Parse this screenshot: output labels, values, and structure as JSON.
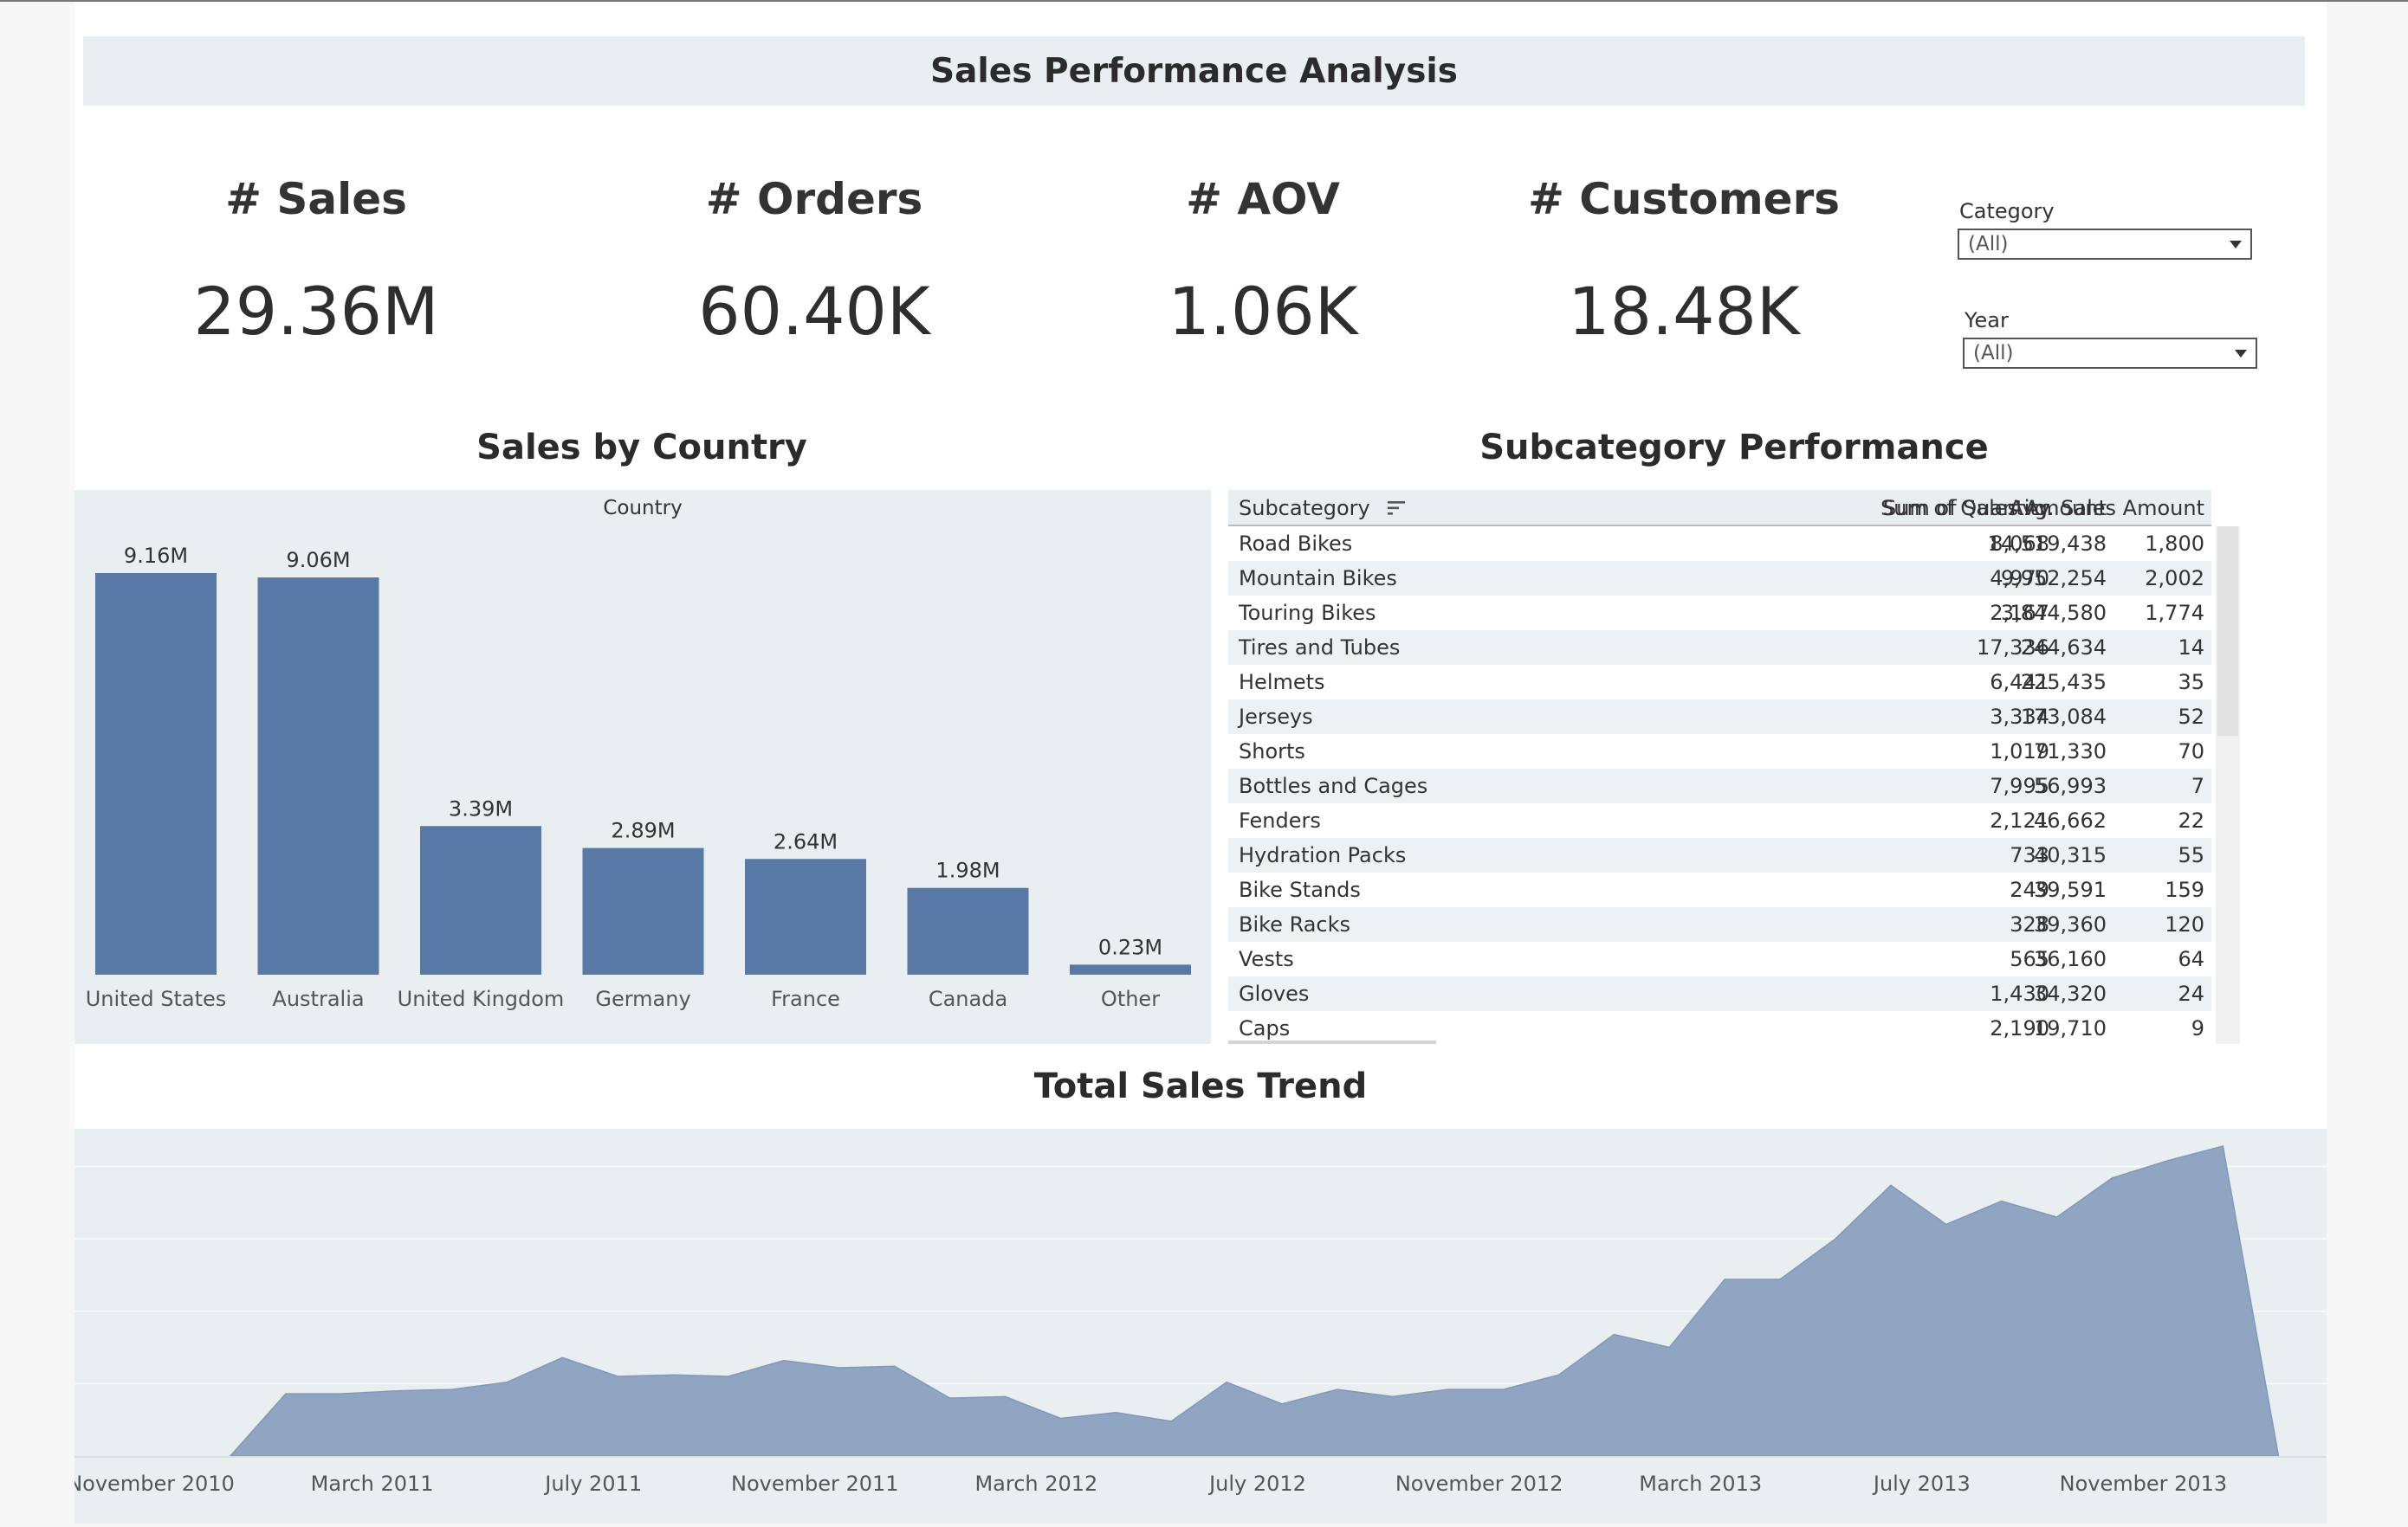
{
  "dashboard": {
    "title": "Sales Performance Analysis"
  },
  "kpis": [
    {
      "label": "# Sales",
      "value": "29.36M"
    },
    {
      "label": "# Orders",
      "value": "60.40K"
    },
    {
      "label": "# AOV",
      "value": "1.06K"
    },
    {
      "label": "# Customers",
      "value": "18.48K"
    }
  ],
  "filters": {
    "category": {
      "label": "Category",
      "value": "(All)"
    },
    "year": {
      "label": "Year",
      "value": "(All)"
    }
  },
  "country_section": {
    "title": "Sales by Country"
  },
  "subcategory_section": {
    "title": "Subcategory Performance"
  },
  "trend_section": {
    "title": "Total Sales Trend"
  },
  "colors": {
    "bar": "#5879a6",
    "area": "#8fa5c2",
    "panel": "#e9eef1"
  },
  "subcategory_table": {
    "headers": [
      "Subcategory",
      "Sum of Quantity",
      "Sum of Sales Amount",
      "Avg. Sales Amount"
    ],
    "sort_icon": "sort-descending-icon",
    "rows": [
      [
        "Road Bikes",
        "8,068",
        "14,519,438",
        "1,800"
      ],
      [
        "Mountain Bikes",
        "4,970",
        "9,952,254",
        "2,002"
      ],
      [
        "Touring Bikes",
        "2,167",
        "3,844,580",
        "1,774"
      ],
      [
        "Tires and Tubes",
        "17,336",
        "244,634",
        "14"
      ],
      [
        "Helmets",
        "6,441",
        "225,435",
        "35"
      ],
      [
        "Jerseys",
        "3,334",
        "173,084",
        "52"
      ],
      [
        "Shorts",
        "1,019",
        "71,330",
        "70"
      ],
      [
        "Bottles and Cages",
        "7,995",
        "56,993",
        "7"
      ],
      [
        "Fenders",
        "2,121",
        "46,662",
        "22"
      ],
      [
        "Hydration Packs",
        "733",
        "40,315",
        "55"
      ],
      [
        "Bike Stands",
        "249",
        "39,591",
        "159"
      ],
      [
        "Bike Racks",
        "328",
        "39,360",
        "120"
      ],
      [
        "Vests",
        "565",
        "36,160",
        "64"
      ],
      [
        "Gloves",
        "1,430",
        "34,320",
        "24"
      ],
      [
        "Caps",
        "2,190",
        "19,710",
        "9"
      ]
    ]
  },
  "chart_data": [
    {
      "type": "bar",
      "title": "Sales by Country",
      "header": "Country",
      "categories": [
        "United States",
        "Australia",
        "United Kingdom",
        "Germany",
        "France",
        "Canada",
        "Other"
      ],
      "values": [
        9.16,
        9.06,
        3.39,
        2.89,
        2.64,
        1.98,
        0.23
      ],
      "data_labels": [
        "9.16M",
        "9.06M",
        "3.39M",
        "2.89M",
        "2.64M",
        "1.98M",
        "0.23M"
      ],
      "unit": "M",
      "ylim": [
        0,
        9.16
      ],
      "grid": false,
      "legend": "none"
    },
    {
      "type": "area",
      "title": "Total Sales Trend",
      "x_start": "2010-12",
      "x_ticks": [
        "November 2010",
        "March 2011",
        "July 2011",
        "November 2011",
        "March 2012",
        "July 2012",
        "November 2012",
        "March 2013",
        "July 2013",
        "November 2013"
      ],
      "x": [
        "2010-12",
        "2011-01",
        "2011-02",
        "2011-03",
        "2011-04",
        "2011-05",
        "2011-06",
        "2011-07",
        "2011-08",
        "2011-09",
        "2011-10",
        "2011-11",
        "2011-12",
        "2012-01",
        "2012-02",
        "2012-03",
        "2012-04",
        "2012-05",
        "2012-06",
        "2012-07",
        "2012-08",
        "2012-09",
        "2012-10",
        "2012-11",
        "2012-12",
        "2013-01",
        "2013-02",
        "2013-03",
        "2013-04",
        "2013-05",
        "2013-06",
        "2013-07",
        "2013-08",
        "2013-09",
        "2013-10",
        "2013-11",
        "2013-12",
        "2014-01"
      ],
      "values": [
        0.0,
        0.43,
        0.43,
        0.45,
        0.46,
        0.51,
        0.68,
        0.55,
        0.56,
        0.55,
        0.66,
        0.61,
        0.62,
        0.4,
        0.41,
        0.26,
        0.3,
        0.24,
        0.51,
        0.36,
        0.46,
        0.41,
        0.46,
        0.46,
        0.56,
        0.84,
        0.75,
        1.22,
        1.22,
        1.5,
        1.87,
        1.6,
        1.76,
        1.65,
        1.92,
        2.04,
        2.14,
        0.01
      ],
      "ylim": [
        0,
        2.2
      ],
      "grid": true,
      "legend": "none"
    }
  ]
}
